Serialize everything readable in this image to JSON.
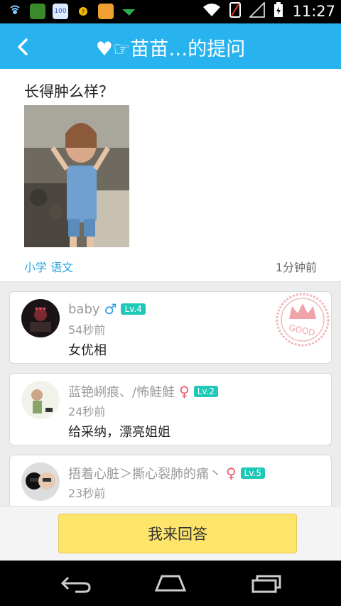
{
  "status_bar": {
    "time": "11:27",
    "left_icons": [
      "signal-app-icon",
      "green-app-icon",
      "100-app-icon",
      "weather-sun-icon",
      "yellow-box-app-icon",
      "green-plane-app-icon"
    ],
    "right_icons": [
      "wifi-icon",
      "sim-icon",
      "cell-signal-icon",
      "battery-icon"
    ]
  },
  "header": {
    "title": "♥☞苗苗…的提问",
    "back_icon": "chevron-left-icon"
  },
  "question": {
    "text": "长得肿么样？",
    "tags": "小学 语文",
    "time": "1分钟前"
  },
  "answers": [
    {
      "name": "baby",
      "gender": "♂",
      "gender_type": "male",
      "level": "Lv.4",
      "time": "54秒前",
      "text": "女优相",
      "badge": "GOOD"
    },
    {
      "name": "蓝铯峢痕、/怖鮭鮭",
      "gender": "♀",
      "gender_type": "female",
      "level": "Lv.2",
      "time": "24秒前",
      "text": "给采纳，漂亮姐姐"
    },
    {
      "name": "捂着心脏＞撕心裂肺的痛丶",
      "gender": "♀",
      "gender_type": "female",
      "level": "Lv.5",
      "time": "23秒前",
      "text": ""
    }
  ],
  "actions": {
    "answer_label": "我来回答"
  },
  "colors": {
    "header_bg": "#29b3ee",
    "accent_text": "#2aa7de",
    "level_badge": "#1fc8b8",
    "answer_button": "#fde46a"
  }
}
